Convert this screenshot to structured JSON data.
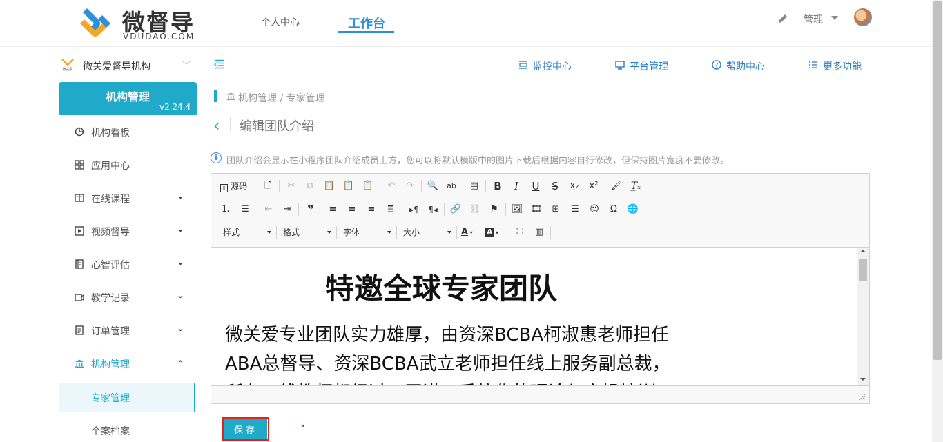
{
  "brand": {
    "name": "微督导",
    "domain": "VDUDAO.COM"
  },
  "top_nav": {
    "personal": "个人中心",
    "workbench": "工作台",
    "admin": "管理"
  },
  "org": {
    "name": "微关爱督导机构",
    "logo_text": "微关爱"
  },
  "sidebar": {
    "title": "机构管理",
    "version": "v2.24.4",
    "items": [
      {
        "label": "机构看板",
        "icon": "pie-chart-icon",
        "expandable": false
      },
      {
        "label": "应用中心",
        "icon": "grid-icon",
        "expandable": false
      },
      {
        "label": "在线课程",
        "icon": "book-icon",
        "expandable": true
      },
      {
        "label": "视频督导",
        "icon": "video-play-icon",
        "expandable": true
      },
      {
        "label": "心智评估",
        "icon": "notebook-icon",
        "expandable": true
      },
      {
        "label": "教学记录",
        "icon": "camera-icon",
        "expandable": true
      },
      {
        "label": "订单管理",
        "icon": "receipt-icon",
        "expandable": true
      },
      {
        "label": "机构管理",
        "icon": "bank-icon",
        "expandable": true,
        "expanded": true
      }
    ],
    "sub_items": [
      "专家管理",
      "个案档案"
    ]
  },
  "header_links": {
    "monitor": "监控中心",
    "platform": "平台管理",
    "help": "帮助中心",
    "more": "更多功能"
  },
  "breadcrumb": "机构管理 / 专家管理",
  "page_title": "编辑团队介绍",
  "info_text": "团队介绍会显示在小程序团队介绍成员上方，您可以将默认模版中的图片下载后根据内容自行修改，但保持图片宽度不要修改。",
  "toolbar": {
    "source": "源码",
    "style": "样式",
    "format": "格式",
    "font": "字体",
    "size": "大小"
  },
  "editor_content": {
    "title": "特邀全球专家团队",
    "line1": "微关爱专业团队实力雄厚，由资深BCBA柯淑惠老师担任",
    "line2": "ABA总督导、资深BCBA武立老师担任线上服务副总裁，",
    "line3": "所有一线教师都经过了严谨、系统化的理论与实操培训"
  },
  "save_label": "保存",
  "colors": {
    "accent": "#1faac9",
    "link": "#2b7fc9",
    "highlight": "#e2231a"
  }
}
